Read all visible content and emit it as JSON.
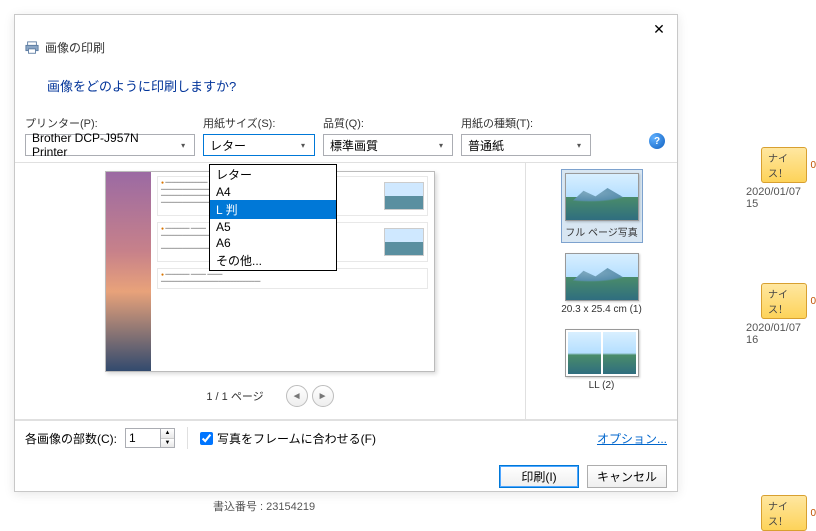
{
  "dialog": {
    "title": "画像の印刷",
    "question": "画像をどのように印刷しますか?",
    "labels": {
      "printer": "プリンター(P):",
      "paper_size": "用紙サイズ(S):",
      "quality": "品質(Q):",
      "paper_type": "用紙の種類(T):"
    },
    "printer": "Brother DCP-J957N Printer",
    "paper_size_selected": "レター",
    "paper_size_options": [
      "レター",
      "A4",
      "L 判",
      "A5",
      "A6",
      "その他..."
    ],
    "paper_size_highlight": "L 判",
    "quality": "標準画質",
    "paper_type": "普通紙",
    "pager": "1 / 1 ページ",
    "layouts": [
      {
        "label": "フル ページ写真",
        "selected": true,
        "type": "single"
      },
      {
        "label": "20.3 x 25.4 cm (1)",
        "selected": false,
        "type": "single"
      },
      {
        "label": "LL (2)",
        "selected": false,
        "type": "double"
      }
    ],
    "copies_label": "各画像の部数(C):",
    "copies_value": "1",
    "fit_frame_label": "写真をフレームに合わせる(F)",
    "options_link": "オプション...",
    "print_btn": "印刷(I)",
    "cancel_btn": "キャンセル"
  },
  "background": {
    "code_line": "書込番号 : 23154219",
    "nice_label": "ナイス！",
    "nice_count": "0",
    "dates": [
      "2020/01/07 15",
      "2020/01/07 16"
    ]
  }
}
